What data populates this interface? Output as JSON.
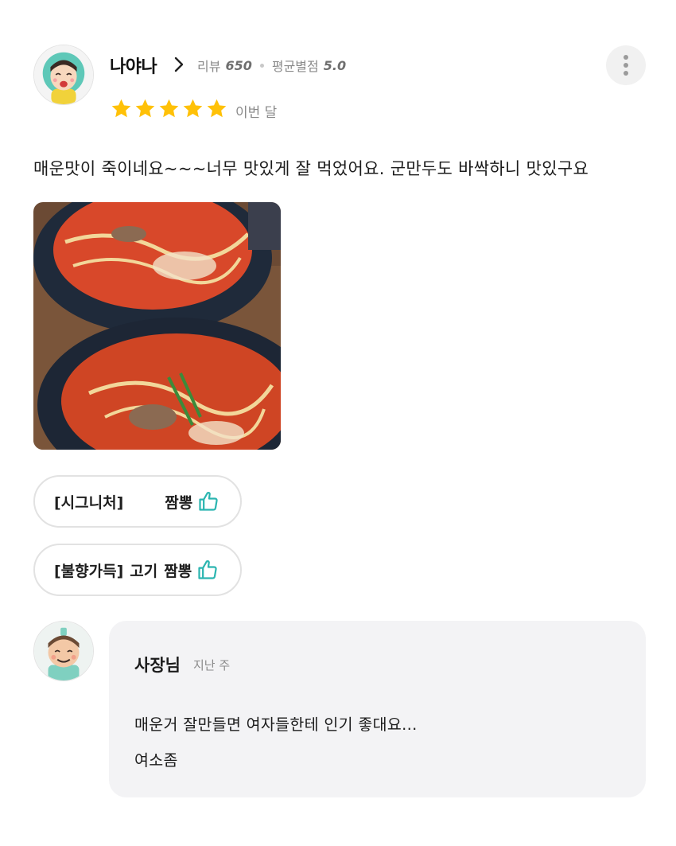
{
  "review": {
    "reviewer_name": "나야나",
    "review_count_label": "리뷰",
    "review_count": "650",
    "avg_rating_label": "평균별점",
    "avg_rating": "5.0",
    "rating_stars": 5,
    "date": "이번 달",
    "text": "매운맛이 죽이네요~~~너무 맛있게 잘 먹었어요. 군만두도 바싹하니 맛있구요",
    "photo_icon": "food-photo"
  },
  "menu_chips": [
    {
      "prefix": "[시그니처]",
      "name": "짬뽕",
      "icon": "thumbs-up-icon"
    },
    {
      "prefix": "[불향가득]",
      "middle": "고기",
      "name": "짬뽕",
      "icon": "thumbs-up-icon"
    }
  ],
  "owner_reply": {
    "name": "사장님",
    "date": "지난 주",
    "lines": [
      "매운거 잘만들면 여자들한테 인기 좋대요...",
      "여소좀"
    ]
  },
  "colors": {
    "star": "#ffc107",
    "thumb_icon": "#2bb5b0",
    "reply_bg": "#f3f3f5",
    "chip_border": "#e2e2e2"
  }
}
